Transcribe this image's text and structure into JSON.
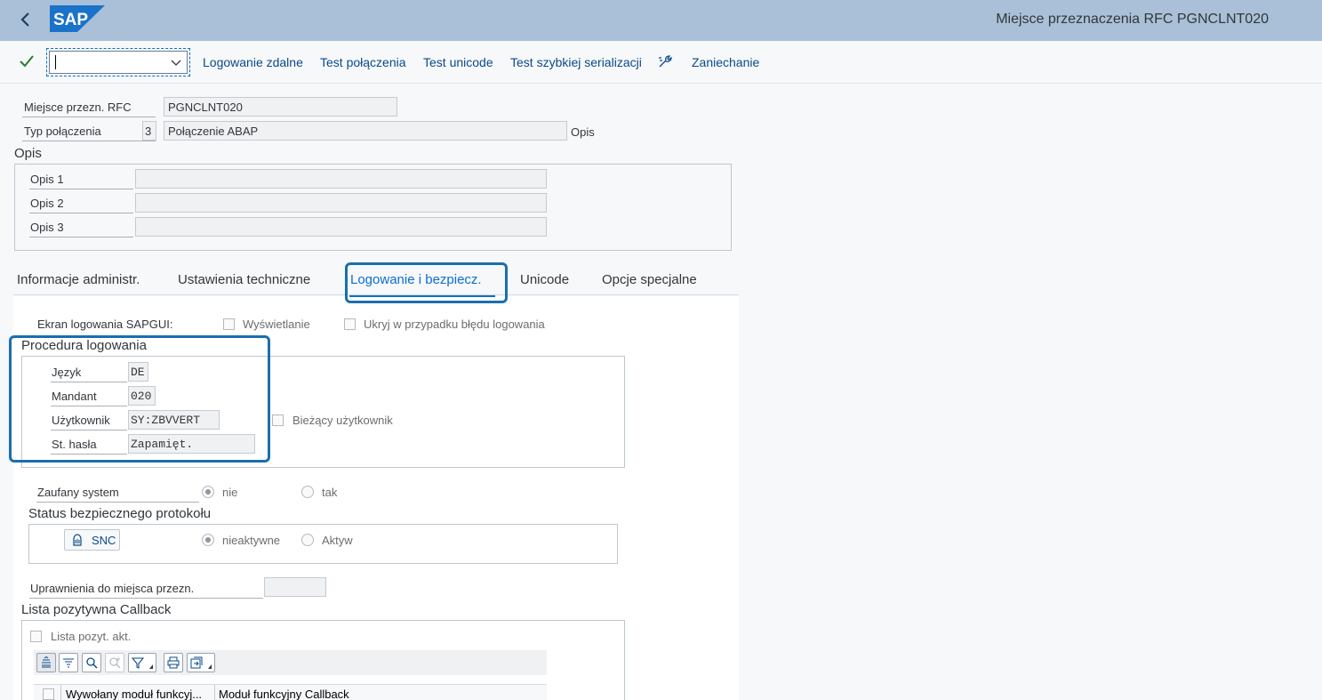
{
  "shell": {
    "title": "Miejsce przeznaczenia RFC PGNCLNT020",
    "logo_text": "SAP"
  },
  "toolbar": {
    "command_value": "",
    "buttons": [
      "Logowanie zdalne",
      "Test połączenia",
      "Test unicode",
      "Test szybkiej serializacji",
      "Zaniechanie"
    ]
  },
  "header": {
    "dest_label": "Miejsce przezn. RFC",
    "dest_value": "PGNCLNT020",
    "type_label": "Typ połączenia",
    "type_code": "3",
    "type_value": "Połączenie ABAP",
    "type_suffix": "Opis"
  },
  "description": {
    "title": "Opis",
    "rows": [
      {
        "label": "Opis 1",
        "value": ""
      },
      {
        "label": "Opis 2",
        "value": ""
      },
      {
        "label": "Opis 3",
        "value": ""
      }
    ]
  },
  "tabs": [
    {
      "label": "Informacje administr.",
      "active": false
    },
    {
      "label": "Ustawienia techniczne",
      "active": false
    },
    {
      "label": "Logowanie i bezpiecz.",
      "active": true
    },
    {
      "label": "Unicode",
      "active": false
    },
    {
      "label": "Opcje specjalne",
      "active": false
    }
  ],
  "logon": {
    "sapgui_label": "Ekran logowania SAPGUI:",
    "sapgui_show": "Wyświetlanie",
    "sapgui_hide_error": "Ukryj w przypadku błędu logowania",
    "procedure_title": "Procedura logowania",
    "language_label": "Język",
    "language_value": "DE",
    "client_label": "Mandant",
    "client_value": "020",
    "user_label": "Użytkownik",
    "user_value": "SY:ZBVVERT",
    "current_user_label": "Bieżący użytkownik",
    "pw_label": "St. hasła",
    "pw_value": "Zapamięt."
  },
  "trusted": {
    "label": "Zaufany system",
    "opt_no": "nie",
    "opt_yes": "tak",
    "selected": "nie"
  },
  "snc": {
    "title": "Status bezpiecznego protokołu",
    "button": "SNC",
    "opt_inactive": "nieaktywne",
    "opt_active": "Aktyw",
    "selected": "nieaktywne"
  },
  "authorization": {
    "label": "Uprawnienia do miejsca przezn.",
    "value": ""
  },
  "callback": {
    "title": "Lista pozytywna Callback",
    "checkbox_label": "Lista pozyt. akt.",
    "columns": [
      "Wywołany moduł funkcyj...",
      "Moduł funkcyjny Callback"
    ]
  },
  "colors": {
    "shell_bg": "#a9c0d8",
    "accent": "#0a6ed1",
    "highlight": "#1a6fb0",
    "check": "#2b7d2b"
  }
}
